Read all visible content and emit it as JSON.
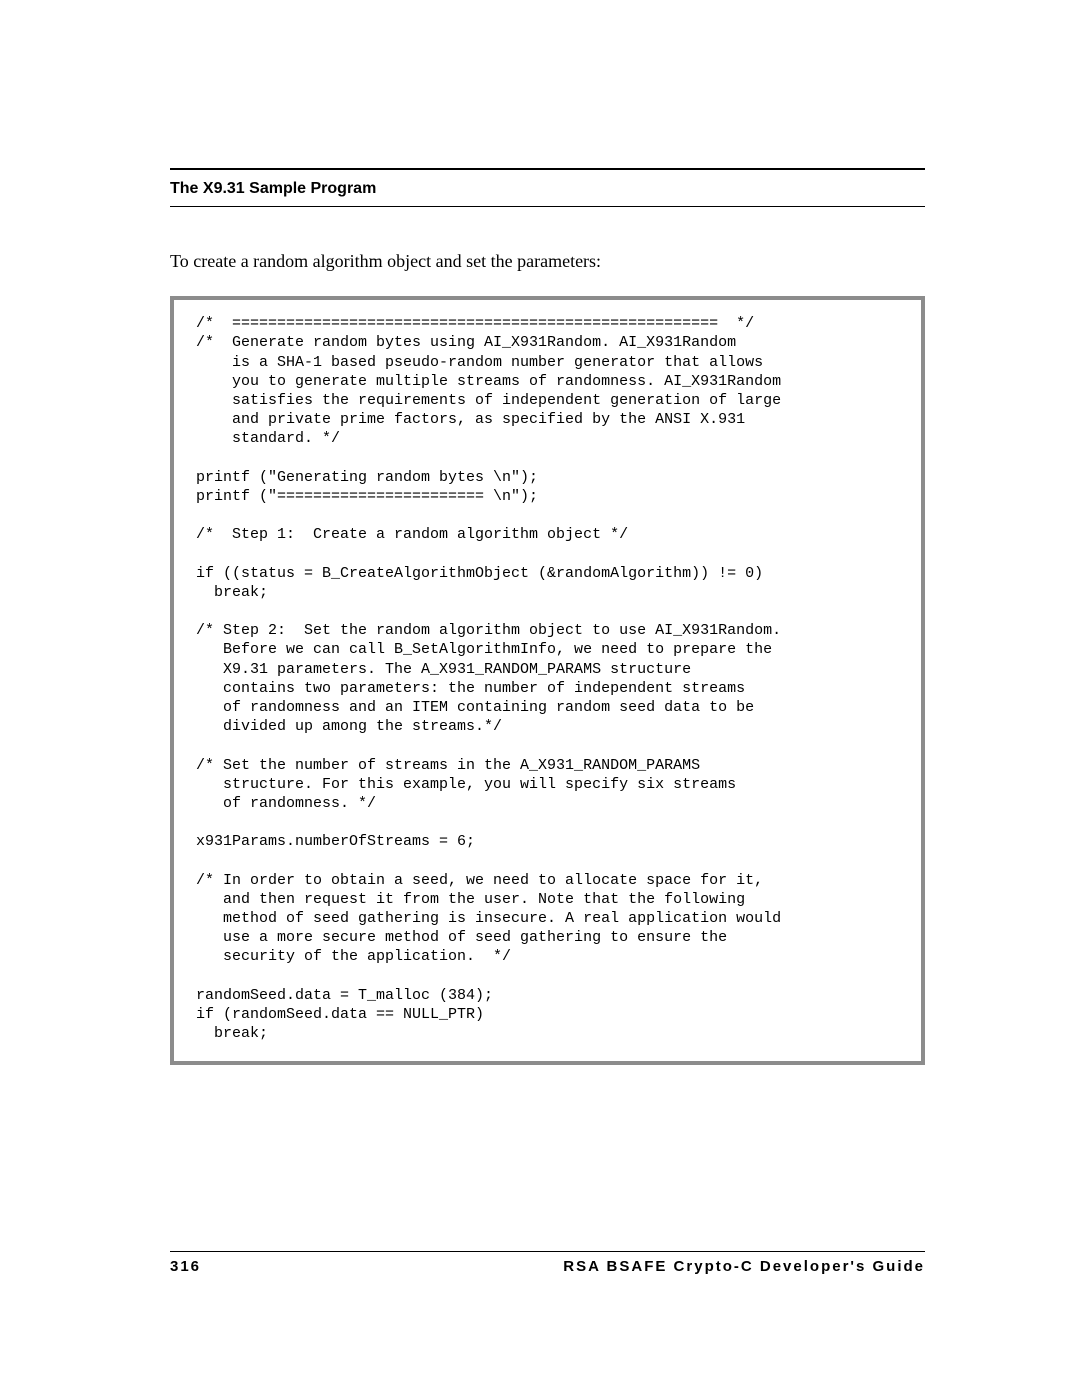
{
  "header": {
    "title": "The X9.31 Sample Program"
  },
  "intro": "To create a random algorithm object and set the parameters:",
  "code": "/*  ======================================================  */\n/*  Generate random bytes using AI_X931Random. AI_X931Random\n    is a SHA-1 based pseudo-random number generator that allows\n    you to generate multiple streams of randomness. AI_X931Random\n    satisfies the requirements of independent generation of large\n    and private prime factors, as specified by the ANSI X.931\n    standard. */\n\nprintf (\"Generating random bytes \\n\");\nprintf (\"======================= \\n\");\n\n/*  Step 1:  Create a random algorithm object */\n\nif ((status = B_CreateAlgorithmObject (&randomAlgorithm)) != 0)\n  break;\n\n/* Step 2:  Set the random algorithm object to use AI_X931Random.\n   Before we can call B_SetAlgorithmInfo, we need to prepare the\n   X9.31 parameters. The A_X931_RANDOM_PARAMS structure\n   contains two parameters: the number of independent streams\n   of randomness and an ITEM containing random seed data to be\n   divided up among the streams.*/\n\n/* Set the number of streams in the A_X931_RANDOM_PARAMS\n   structure. For this example, you will specify six streams\n   of randomness. */\n\nx931Params.numberOfStreams = 6;\n\n/* In order to obtain a seed, we need to allocate space for it,\n   and then request it from the user. Note that the following\n   method of seed gathering is insecure. A real application would\n   use a more secure method of seed gathering to ensure the\n   security of the application.  */\n\nrandomSeed.data = T_malloc (384);\nif (randomSeed.data == NULL_PTR)\n  break;",
  "footer": {
    "page_number": "316",
    "book_title": "RSA BSAFE Crypto-C Developer's Guide"
  }
}
